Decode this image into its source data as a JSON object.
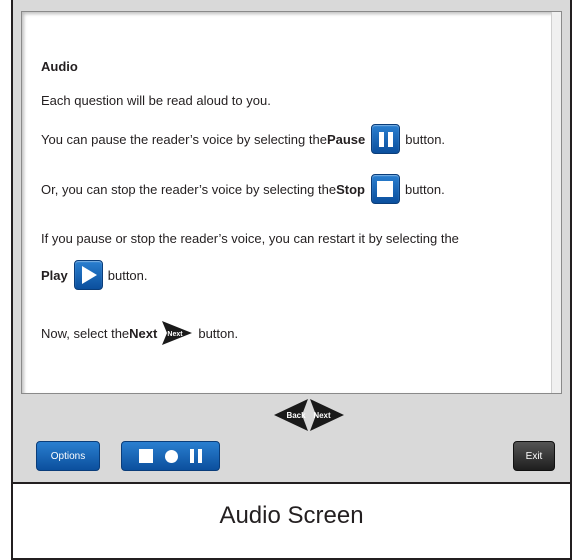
{
  "content": {
    "heading": "Audio",
    "line1": "Each question will be read aloud to you.",
    "line2_pre": "You can pause the reader’s voice by selecting the ",
    "line2_bold": "Pause",
    "line2_post": " button.",
    "line3_pre": "Or, you can stop the reader’s voice by selecting the ",
    "line3_bold": "Stop",
    "line3_post": " button.",
    "line4": "If you pause or stop the reader’s voice, you can restart it by selecting the",
    "line5_bold": "Play",
    "line5_post": " button.",
    "line6_pre": "Now, select the ",
    "line6_bold": "Next",
    "line6_post": " button."
  },
  "nav": {
    "back_label": "Back",
    "next_label": "Next"
  },
  "toolbar": {
    "options_label": "Options",
    "exit_label": "Exit"
  },
  "caption": "Audio Screen",
  "colors": {
    "button_blue": "#0b4f9d",
    "panel_gray": "#d9d9d9",
    "exit_dark": "#1e1e1e"
  }
}
